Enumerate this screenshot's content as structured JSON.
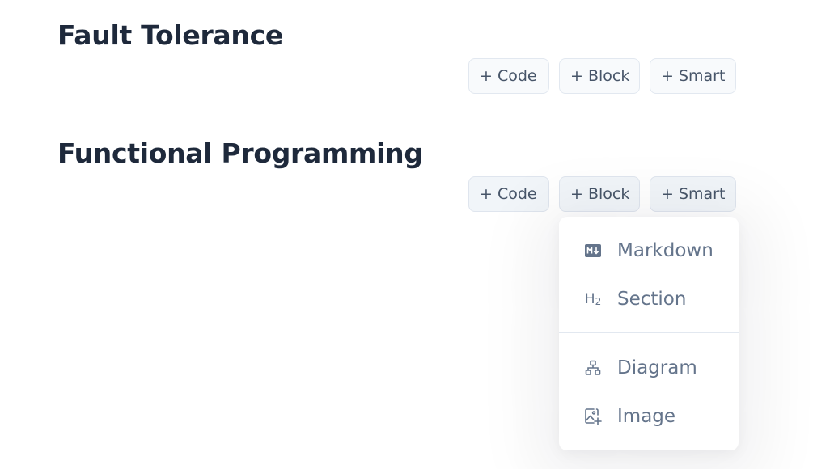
{
  "sections": [
    {
      "title": "Fault Tolerance",
      "buttons": {
        "code": "+ Code",
        "block": "+ Block",
        "smart": "+ Smart"
      }
    },
    {
      "title": "Functional Programming",
      "buttons": {
        "code": "+ Code",
        "block": "+ Block",
        "smart": "+ Smart"
      }
    }
  ],
  "block_menu": {
    "items": [
      {
        "label": "Markdown",
        "icon": "markdown-icon"
      },
      {
        "label": "Section",
        "icon": "heading-2-icon",
        "icon_text": "H",
        "icon_sub": "2"
      },
      {
        "label": "Diagram",
        "icon": "diagram-icon"
      },
      {
        "label": "Image",
        "icon": "image-add-icon"
      }
    ]
  },
  "colors": {
    "title": "#1e293b",
    "button_text": "#475569",
    "button_bg": "#f8fafc",
    "button_border": "#e2e8f0",
    "menu_text": "#64748b"
  }
}
